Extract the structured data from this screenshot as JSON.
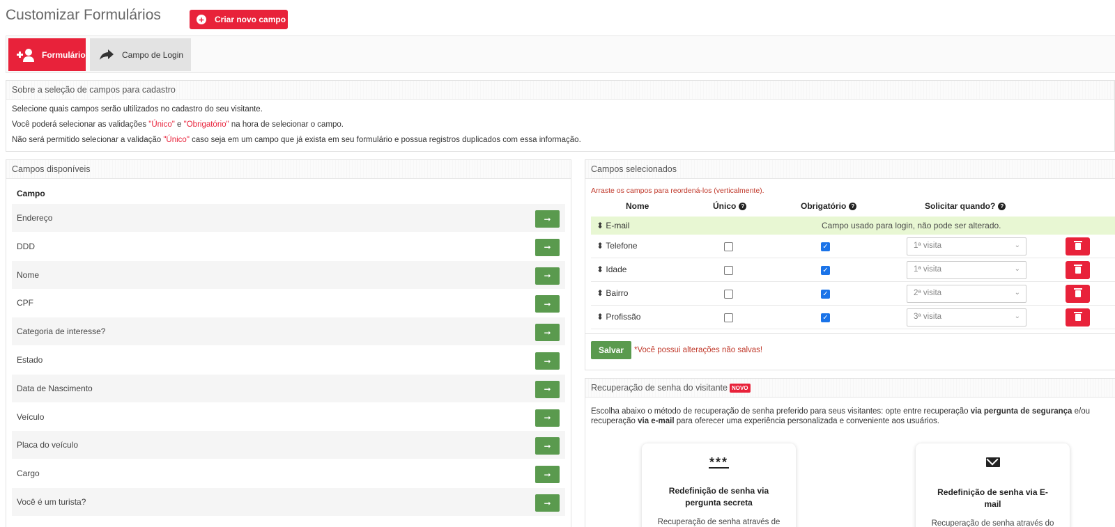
{
  "header": {
    "title": "Customizar Formulários",
    "new_field_label": "Criar novo campo"
  },
  "tabs": [
    {
      "label": "Formulário",
      "active": true
    },
    {
      "label": "Campo de Login",
      "active": false
    }
  ],
  "about": {
    "title": "Sobre a seleção de campos para cadastro",
    "line1": "Selecione quais campos serão ultilizados no cadastro do seu visitante.",
    "line2_a": "Você poderá selecionar as validações ",
    "line2_unique": "\"Único\"",
    "line2_and": " e ",
    "line2_required": "\"Obrigatório\"",
    "line2_b": " na hora de selecionar o campo.",
    "line3_a": "Não será permitido selecionar a validação ",
    "line3_unique": "\"Único\"",
    "line3_b": " caso seja em um campo que já exista em seu formulário e possua registros duplicados com essa informação."
  },
  "available": {
    "title": "Campos disponíveis",
    "column": "Campo",
    "fields": [
      "Endereço",
      "DDD",
      "Nome",
      "CPF",
      "Categoria de interesse?",
      "Estado",
      "Data de Nascimento",
      "Veículo",
      "Placa do veículo",
      "Cargo",
      "Você é um turista?"
    ]
  },
  "selected": {
    "title": "Campos selecionados",
    "hint": "Arraste os campos para reordená-los (verticalmente).",
    "headers": {
      "name": "Nome",
      "unique": "Único",
      "required": "Obrigatório",
      "when": "Solicitar quando?"
    },
    "email": {
      "name": "E-mail",
      "note": "Campo usado para login, não pode ser alterado."
    },
    "rows": [
      {
        "name": "Telefone",
        "unique": false,
        "required": true,
        "when": "1ª visita"
      },
      {
        "name": "Idade",
        "unique": false,
        "required": true,
        "when": "1ª visita"
      },
      {
        "name": "Bairro",
        "unique": false,
        "required": true,
        "when": "2ª visita"
      },
      {
        "name": "Profissão",
        "unique": false,
        "required": true,
        "when": "3ª visita"
      }
    ],
    "save_label": "Salvar",
    "unsaved": "*Você possui alterações não salvas!"
  },
  "recovery": {
    "title": "Recuperação de senha do visitante",
    "badge": "NOVO",
    "text_a": "Escolha abaixo o método de recuperação de senha preferido para seus visitantes: opte entre recuperação ",
    "text_bold1": "via pergunta de segurança",
    "text_b": " e/ou recuperação ",
    "text_bold2": "via e-mail",
    "text_c": " para oferecer uma experiência personalizada e conveniente aos usuários.",
    "cards": [
      {
        "icon_text": "***",
        "title": "Redefinição de senha via pergunta secreta",
        "desc": "Recuperação de senha através de"
      },
      {
        "icon_text": "",
        "title": "Redefinição de senha via E-mail",
        "desc": "Recuperação de senha através do envio de uma senha provisória para"
      }
    ]
  },
  "colors": {
    "accent": "#e8223a",
    "success": "#5a9a4e",
    "email_row": "#e8f7d3"
  }
}
